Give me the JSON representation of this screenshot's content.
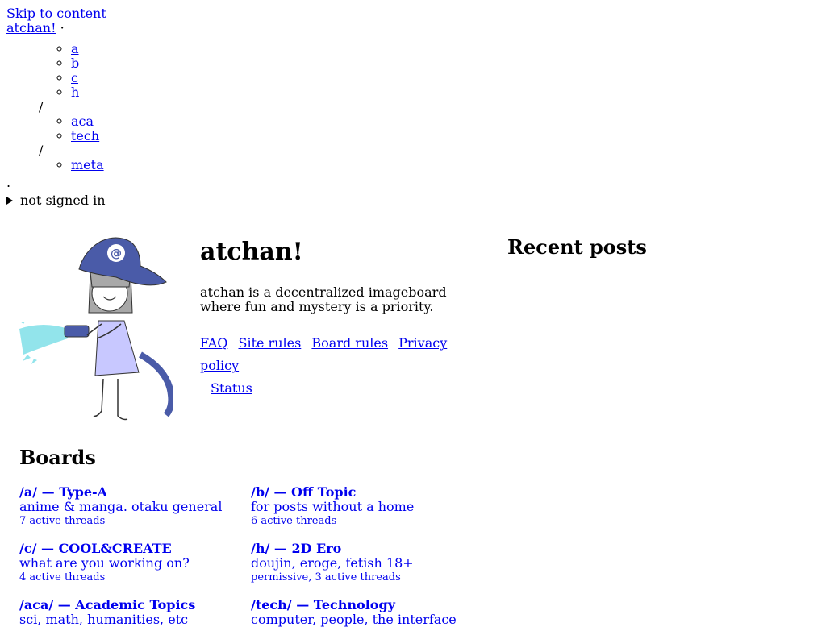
{
  "header": {
    "skip_link": "Skip to content",
    "site_link": "atchan!",
    "site_sep": "·",
    "nav_groups": [
      [
        "a",
        "b",
        "c",
        "h"
      ],
      [
        "aca",
        "tech"
      ],
      [
        "meta"
      ]
    ],
    "group_sep": "/",
    "end_dot": ".",
    "account_summary": "not signed in"
  },
  "hero": {
    "title": "atchan!",
    "description": "atchan is a decentralized imageboard where fun and mystery is a priority.",
    "links": [
      "FAQ",
      "Site rules",
      "Board rules",
      "Privacy policy",
      "Status"
    ]
  },
  "recent": {
    "title": "Recent posts"
  },
  "boards": {
    "title": "Boards",
    "items": [
      {
        "name": "/a/ — Type-A",
        "desc": "anime & manga. otaku general",
        "meta": "7 active threads"
      },
      {
        "name": "/b/ — Off Topic",
        "desc": "for posts without a home",
        "meta": "6 active threads"
      },
      {
        "name": "/c/ — COOL&CREATE",
        "desc": "what are you working on?",
        "meta": "4 active threads"
      },
      {
        "name": "/h/ — 2D Ero",
        "desc": "doujin, eroge, fetish 18+",
        "meta": "permissive, 3 active threads"
      },
      {
        "name": "/aca/ — Academic Topics",
        "desc": "sci, math, humanities, etc",
        "meta": ""
      },
      {
        "name": "/tech/ — Technology",
        "desc": "computer, people, the interface",
        "meta": ""
      }
    ]
  },
  "colors": {
    "link": "#0000ee",
    "mascot_hat": "#4a5ba8",
    "mascot_dress": "#c8c8ff",
    "water": "#7fe0e8"
  }
}
